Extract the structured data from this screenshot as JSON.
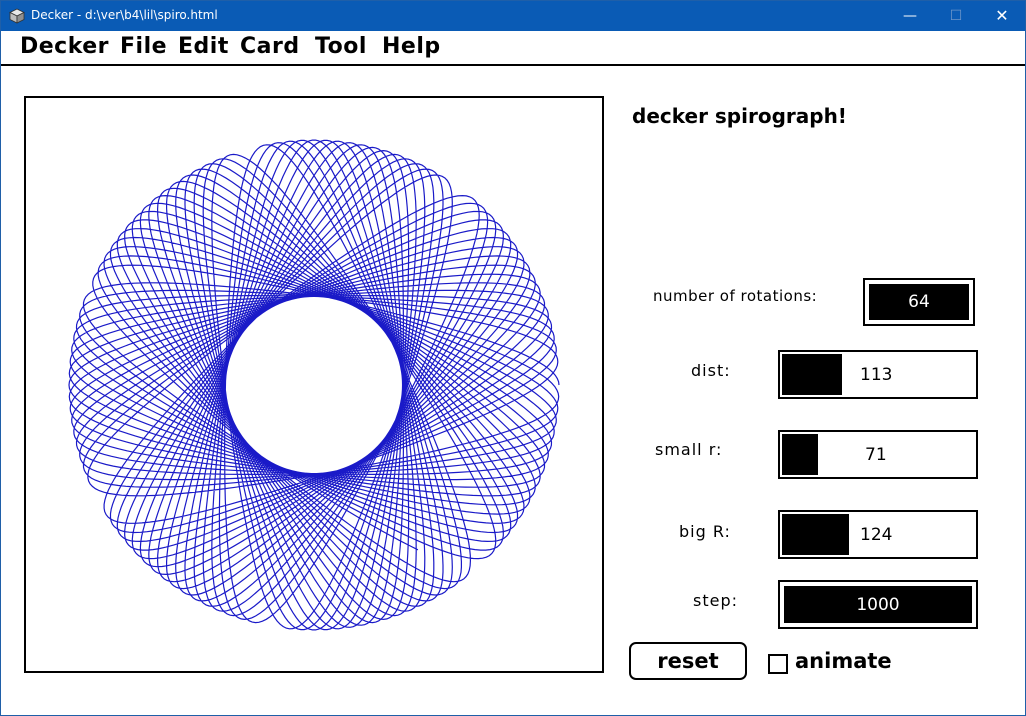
{
  "window": {
    "title": "Decker - d:\\ver\\b4\\lil\\spiro.html",
    "minimize_glyph": "—",
    "maximize_glyph": "☐",
    "close_glyph": "✕",
    "app_icon": "cube-icon",
    "titlebar_color": "#0a5bb5"
  },
  "menubar": {
    "items": [
      "Decker",
      "File",
      "Edit",
      "Card",
      "Tool",
      "Help"
    ]
  },
  "card": {
    "heading": "decker spirograph!",
    "canvas": {
      "stroke_color": "#1a1ac8",
      "params": {
        "R": 124,
        "r": 71,
        "d": 113,
        "rotations": 64
      }
    },
    "rotations": {
      "label": "number of rotations:",
      "value": "64"
    },
    "dist": {
      "label": "dist:",
      "value": "113",
      "level": 0.31
    },
    "small_r": {
      "label": "small r:",
      "value": "71",
      "level": 0.19
    },
    "big_r": {
      "label": "big R:",
      "value": "124",
      "level": 0.35
    },
    "step": {
      "label": "step:",
      "value": "1000"
    },
    "reset_label": "reset",
    "animate_label": "animate",
    "animate_checked": false
  }
}
